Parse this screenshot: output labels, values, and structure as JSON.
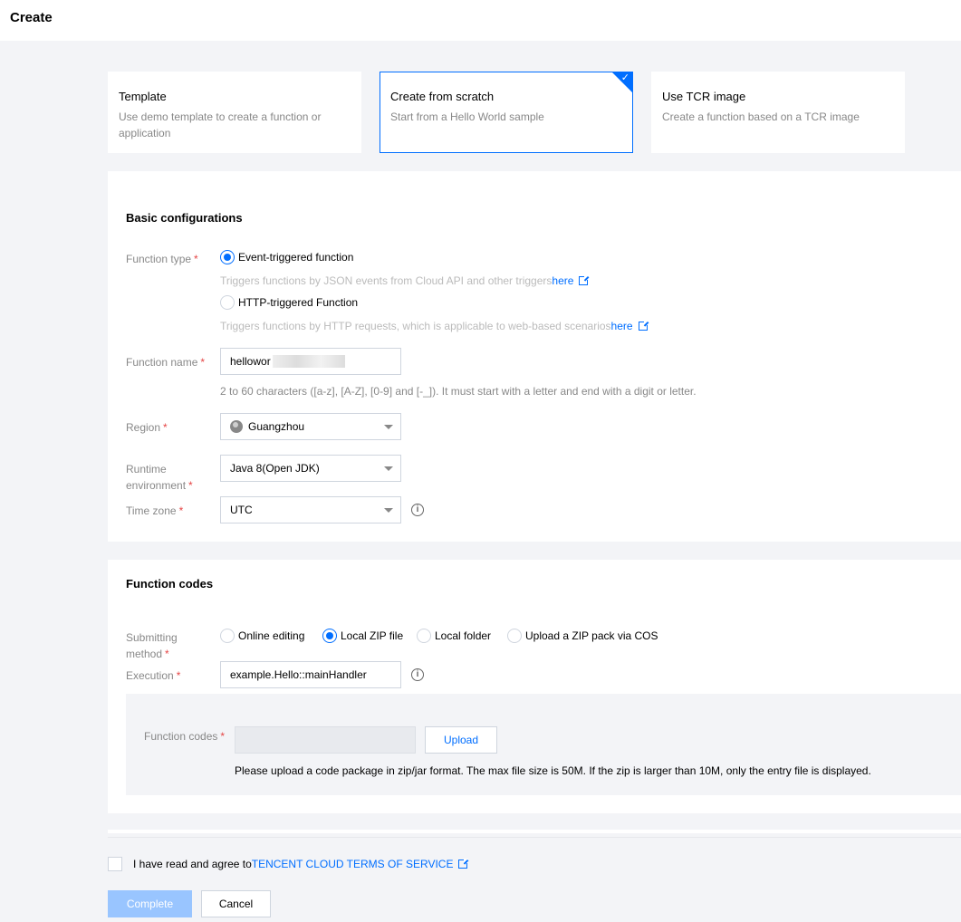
{
  "page": {
    "title": "Create"
  },
  "creation_modes": [
    {
      "title": "Template",
      "description": "Use demo template to create a function or application",
      "selected": false
    },
    {
      "title": "Create from scratch",
      "description": "Start from a Hello World sample",
      "selected": true
    },
    {
      "title": "Use TCR image",
      "description": "Create a function based on a TCR image",
      "selected": false
    }
  ],
  "basic": {
    "section_title": "Basic configurations",
    "function_type": {
      "label": "Function type",
      "options": [
        {
          "label": "Event-triggered function",
          "hint": "Triggers functions by JSON events from Cloud API and other triggers",
          "link": "here",
          "selected": true
        },
        {
          "label": "HTTP-triggered Function",
          "hint": "Triggers functions by HTTP requests, which is applicable to web-based scenarios",
          "link": "here",
          "selected": false
        }
      ]
    },
    "function_name": {
      "label": "Function name",
      "value": "hellowor",
      "hint": "2 to 60 characters ([a-z], [A-Z], [0-9] and [-_]). It must start with a letter and end with a digit or letter."
    },
    "region": {
      "label": "Region",
      "value": "Guangzhou"
    },
    "runtime": {
      "label_line1": "Runtime",
      "label_line2": "environment",
      "value": "Java 8(Open JDK)"
    },
    "timezone": {
      "label": "Time zone",
      "value": "UTC"
    }
  },
  "codes": {
    "section_title": "Function codes",
    "submit_method": {
      "label_line1": "Submitting",
      "label_line2": "method",
      "options": [
        {
          "label": "Online editing",
          "selected": false
        },
        {
          "label": "Local ZIP file",
          "selected": true
        },
        {
          "label": "Local folder",
          "selected": false
        },
        {
          "label": "Upload a ZIP pack via COS",
          "selected": false
        }
      ]
    },
    "execution": {
      "label": "Execution",
      "value": "example.Hello::mainHandler"
    },
    "function_codes": {
      "label": "Function codes",
      "upload_label": "Upload",
      "note": "Please upload a code package in zip/jar format. The max file size is 50M. If the zip is larger than 10M, only the entry file is displayed."
    }
  },
  "footer": {
    "agree_text": "I have read and agree to",
    "terms_link": "TENCENT CLOUD TERMS OF SERVICE",
    "complete_label": "Complete",
    "cancel_label": "Cancel"
  },
  "colors": {
    "accent": "#006eff",
    "required": "#e54545",
    "background": "#f3f4f7"
  }
}
